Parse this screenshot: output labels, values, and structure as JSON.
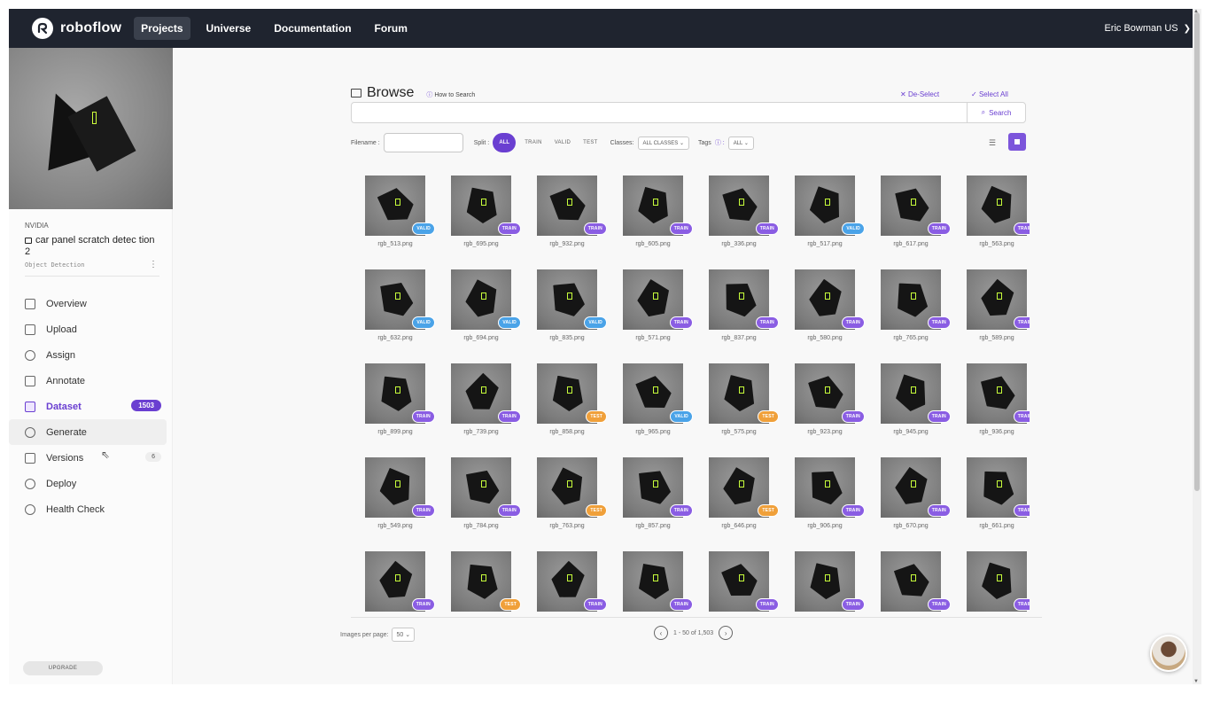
{
  "nav": {
    "brand": "roboflow",
    "links": [
      "Projects",
      "Universe",
      "Documentation",
      "Forum"
    ],
    "user": "Eric Bowman US"
  },
  "sidebar": {
    "org": "NVIDIA",
    "project_name": "car panel scratch detec tion 2",
    "project_type": "Object Detection",
    "items": [
      {
        "label": "Overview",
        "icon": "overview-icon"
      },
      {
        "label": "Upload",
        "icon": "upload-icon"
      },
      {
        "label": "Assign",
        "icon": "assign-icon"
      },
      {
        "label": "Annotate",
        "icon": "annotate-icon"
      },
      {
        "label": "Dataset",
        "icon": "dataset-icon"
      },
      {
        "label": "Generate",
        "icon": "generate-icon"
      },
      {
        "label": "Versions",
        "icon": "versions-icon"
      },
      {
        "label": "Deploy",
        "icon": "deploy-icon"
      },
      {
        "label": "Health Check",
        "icon": "health-check-icon"
      }
    ],
    "dataset_count": "1503",
    "versions_count": "6",
    "upgrade": "UPGRADE"
  },
  "browse": {
    "title": "Browse",
    "how_to_search": "How to Search",
    "deselect": "De-Select",
    "select_all": "Select All",
    "search_button": "Search",
    "search_value": "",
    "filename_label": "Filename :",
    "split_label": "Split :",
    "split_options": [
      "ALL",
      "TRAIN",
      "VALID",
      "TEST"
    ],
    "classes_label": "Classes:",
    "classes_value": "ALL CLASSES",
    "tags_label": "Tags",
    "tags_value": "ALL"
  },
  "images": [
    {
      "name": "rgb_513.png",
      "split": "VALID"
    },
    {
      "name": "rgb_695.png",
      "split": "TRAIN"
    },
    {
      "name": "rgb_932.png",
      "split": "TRAIN"
    },
    {
      "name": "rgb_605.png",
      "split": "TRAIN"
    },
    {
      "name": "rgb_336.png",
      "split": "TRAIN"
    },
    {
      "name": "rgb_517.png",
      "split": "VALID"
    },
    {
      "name": "rgb_617.png",
      "split": "TRAIN"
    },
    {
      "name": "rgb_563.png",
      "split": "TRAIN"
    },
    {
      "name": "rgb_632.png",
      "split": "VALID"
    },
    {
      "name": "rgb_694.png",
      "split": "VALID"
    },
    {
      "name": "rgb_835.png",
      "split": "VALID"
    },
    {
      "name": "rgb_571.png",
      "split": "TRAIN"
    },
    {
      "name": "rgb_837.png",
      "split": "TRAIN"
    },
    {
      "name": "rgb_580.png",
      "split": "TRAIN"
    },
    {
      "name": "rgb_765.png",
      "split": "TRAIN"
    },
    {
      "name": "rgb_589.png",
      "split": "TRAIN"
    },
    {
      "name": "rgb_899.png",
      "split": "TRAIN"
    },
    {
      "name": "rgb_739.png",
      "split": "TRAIN"
    },
    {
      "name": "rgb_858.png",
      "split": "TEST"
    },
    {
      "name": "rgb_965.png",
      "split": "VALID"
    },
    {
      "name": "rgb_575.png",
      "split": "TEST"
    },
    {
      "name": "rgb_923.png",
      "split": "TRAIN"
    },
    {
      "name": "rgb_945.png",
      "split": "TRAIN"
    },
    {
      "name": "rgb_936.png",
      "split": "TRAIN"
    },
    {
      "name": "rgb_549.png",
      "split": "TRAIN"
    },
    {
      "name": "rgb_784.png",
      "split": "TRAIN"
    },
    {
      "name": "rgb_763.png",
      "split": "TEST"
    },
    {
      "name": "rgb_857.png",
      "split": "TRAIN"
    },
    {
      "name": "rgb_646.png",
      "split": "TEST"
    },
    {
      "name": "rgb_906.png",
      "split": "TRAIN"
    },
    {
      "name": "rgb_670.png",
      "split": "TRAIN"
    },
    {
      "name": "rgb_661.png",
      "split": "TRAIN"
    },
    {
      "name": "",
      "split": "TRAIN"
    },
    {
      "name": "",
      "split": "TEST"
    },
    {
      "name": "",
      "split": "TRAIN"
    },
    {
      "name": "",
      "split": "TRAIN"
    },
    {
      "name": "",
      "split": "TRAIN"
    },
    {
      "name": "",
      "split": "TRAIN"
    },
    {
      "name": "",
      "split": "TRAIN"
    },
    {
      "name": "",
      "split": "TRAIN"
    }
  ],
  "footer": {
    "per_page_label": "Images per page:",
    "per_page_value": "50",
    "range": "1 - 50 of 1,503"
  },
  "colors": {
    "accent": "#6a3fd1",
    "train": "#8a5de3",
    "valid": "#4aa3e8",
    "test": "#f0a03a",
    "nav_bg": "#1f242f"
  }
}
